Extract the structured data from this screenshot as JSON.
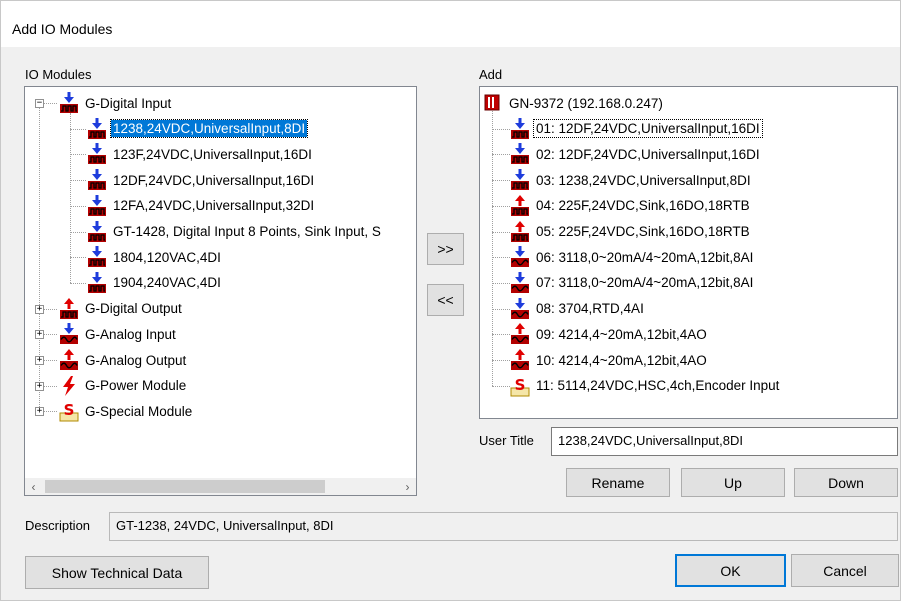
{
  "window": {
    "title": "Add IO Modules"
  },
  "left": {
    "label": "IO Modules",
    "groups": [
      {
        "label": "G-Digital Input",
        "icon": "digital-input-icon",
        "expanded": true,
        "children": [
          {
            "label": "1238,24VDC,UniversalInput,8DI",
            "selected": true
          },
          {
            "label": "123F,24VDC,UniversalInput,16DI"
          },
          {
            "label": "12DF,24VDC,UniversalInput,16DI"
          },
          {
            "label": "12FA,24VDC,UniversalInput,32DI"
          },
          {
            "label": "GT-1428, Digital Input 8 Points, Sink Input, S"
          },
          {
            "label": "1804,120VAC,4DI"
          },
          {
            "label": "1904,240VAC,4DI"
          }
        ]
      },
      {
        "label": "G-Digital Output",
        "icon": "digital-output-icon"
      },
      {
        "label": "G-Analog Input",
        "icon": "analog-input-icon"
      },
      {
        "label": "G-Analog Output",
        "icon": "analog-output-icon"
      },
      {
        "label": "G-Power Module",
        "icon": "power-module-icon"
      },
      {
        "label": "G-Special Module",
        "icon": "special-module-icon"
      }
    ]
  },
  "buttons": {
    "add": ">>",
    "remove": "<<",
    "rename": "Rename",
    "up": "Up",
    "down": "Down",
    "show_tech": "Show Technical Data",
    "ok": "OK",
    "cancel": "Cancel"
  },
  "right": {
    "label": "Add",
    "root": "GN-9372 (192.168.0.247)",
    "items": [
      {
        "label": "01: 12DF,24VDC,UniversalInput,16DI",
        "icon": "digital-input-icon",
        "focused": true
      },
      {
        "label": "02: 12DF,24VDC,UniversalInput,16DI",
        "icon": "digital-input-icon"
      },
      {
        "label": "03: 1238,24VDC,UniversalInput,8DI",
        "icon": "digital-input-icon"
      },
      {
        "label": "04: 225F,24VDC,Sink,16DO,18RTB",
        "icon": "digital-output-icon"
      },
      {
        "label": "05: 225F,24VDC,Sink,16DO,18RTB",
        "icon": "digital-output-icon"
      },
      {
        "label": "06: 3118,0~20mA/4~20mA,12bit,8AI",
        "icon": "analog-input-icon"
      },
      {
        "label": "07: 3118,0~20mA/4~20mA,12bit,8AI",
        "icon": "analog-input-icon"
      },
      {
        "label": "08: 3704,RTD,4AI",
        "icon": "analog-input-icon"
      },
      {
        "label": "09: 4214,4~20mA,12bit,4AO",
        "icon": "analog-output-icon"
      },
      {
        "label": "10: 4214,4~20mA,12bit,4AO",
        "icon": "analog-output-icon"
      },
      {
        "label": "11: 5114,24VDC,HSC,4ch,Encoder Input",
        "icon": "special-module-icon"
      }
    ]
  },
  "user_title": {
    "label": "User Title",
    "value": "1238,24VDC,UniversalInput,8DI"
  },
  "description": {
    "label": "Description",
    "value": "GT-1238, 24VDC, UniversalInput, 8DI"
  },
  "colors": {
    "selection": "#0078d7",
    "module_red": "#cc0000",
    "arrow_blue": "#1e3cdc"
  }
}
